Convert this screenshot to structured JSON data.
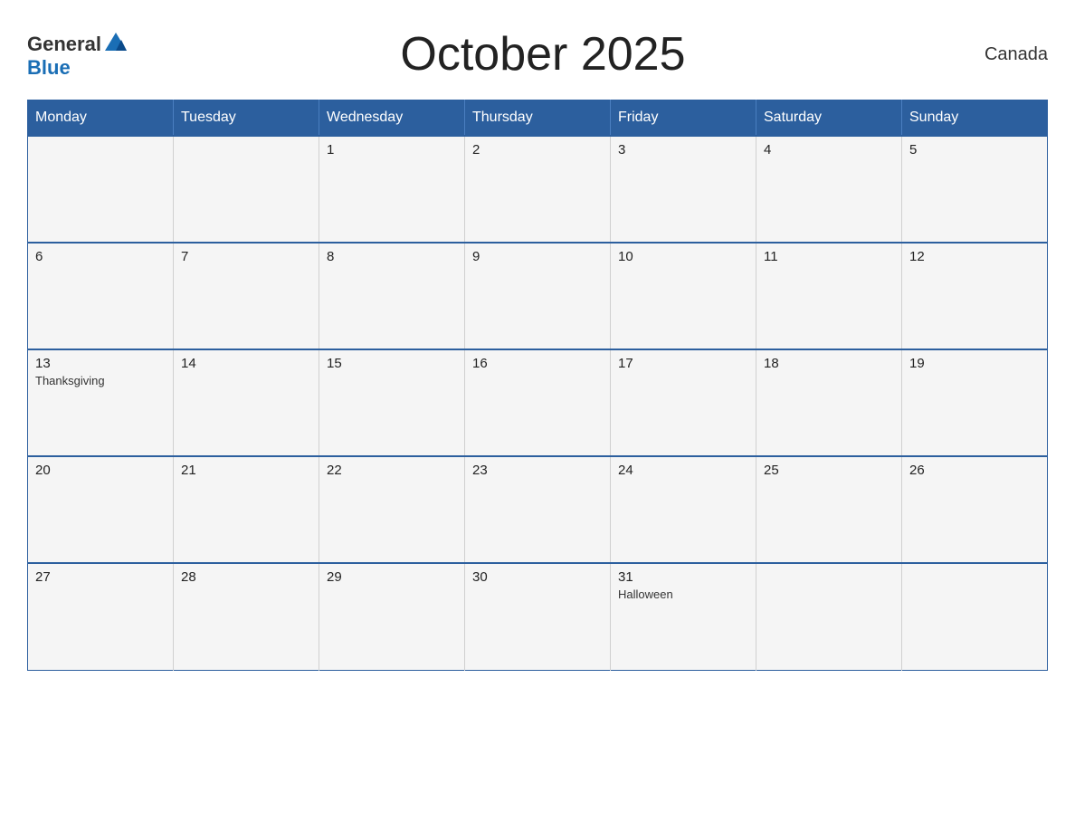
{
  "header": {
    "title": "October 2025",
    "country": "Canada",
    "logo": {
      "line1_regular": "General",
      "line1_icon": "▶",
      "line2_blue": "Blue"
    }
  },
  "calendar": {
    "days_of_week": [
      "Monday",
      "Tuesday",
      "Wednesday",
      "Thursday",
      "Friday",
      "Saturday",
      "Sunday"
    ],
    "weeks": [
      [
        {
          "day": "",
          "event": ""
        },
        {
          "day": "",
          "event": ""
        },
        {
          "day": "1",
          "event": ""
        },
        {
          "day": "2",
          "event": ""
        },
        {
          "day": "3",
          "event": ""
        },
        {
          "day": "4",
          "event": ""
        },
        {
          "day": "5",
          "event": ""
        }
      ],
      [
        {
          "day": "6",
          "event": ""
        },
        {
          "day": "7",
          "event": ""
        },
        {
          "day": "8",
          "event": ""
        },
        {
          "day": "9",
          "event": ""
        },
        {
          "day": "10",
          "event": ""
        },
        {
          "day": "11",
          "event": ""
        },
        {
          "day": "12",
          "event": ""
        }
      ],
      [
        {
          "day": "13",
          "event": "Thanksgiving"
        },
        {
          "day": "14",
          "event": ""
        },
        {
          "day": "15",
          "event": ""
        },
        {
          "day": "16",
          "event": ""
        },
        {
          "day": "17",
          "event": ""
        },
        {
          "day": "18",
          "event": ""
        },
        {
          "day": "19",
          "event": ""
        }
      ],
      [
        {
          "day": "20",
          "event": ""
        },
        {
          "day": "21",
          "event": ""
        },
        {
          "day": "22",
          "event": ""
        },
        {
          "day": "23",
          "event": ""
        },
        {
          "day": "24",
          "event": ""
        },
        {
          "day": "25",
          "event": ""
        },
        {
          "day": "26",
          "event": ""
        }
      ],
      [
        {
          "day": "27",
          "event": ""
        },
        {
          "day": "28",
          "event": ""
        },
        {
          "day": "29",
          "event": ""
        },
        {
          "day": "30",
          "event": ""
        },
        {
          "day": "31",
          "event": "Halloween"
        },
        {
          "day": "",
          "event": ""
        },
        {
          "day": "",
          "event": ""
        }
      ]
    ]
  }
}
